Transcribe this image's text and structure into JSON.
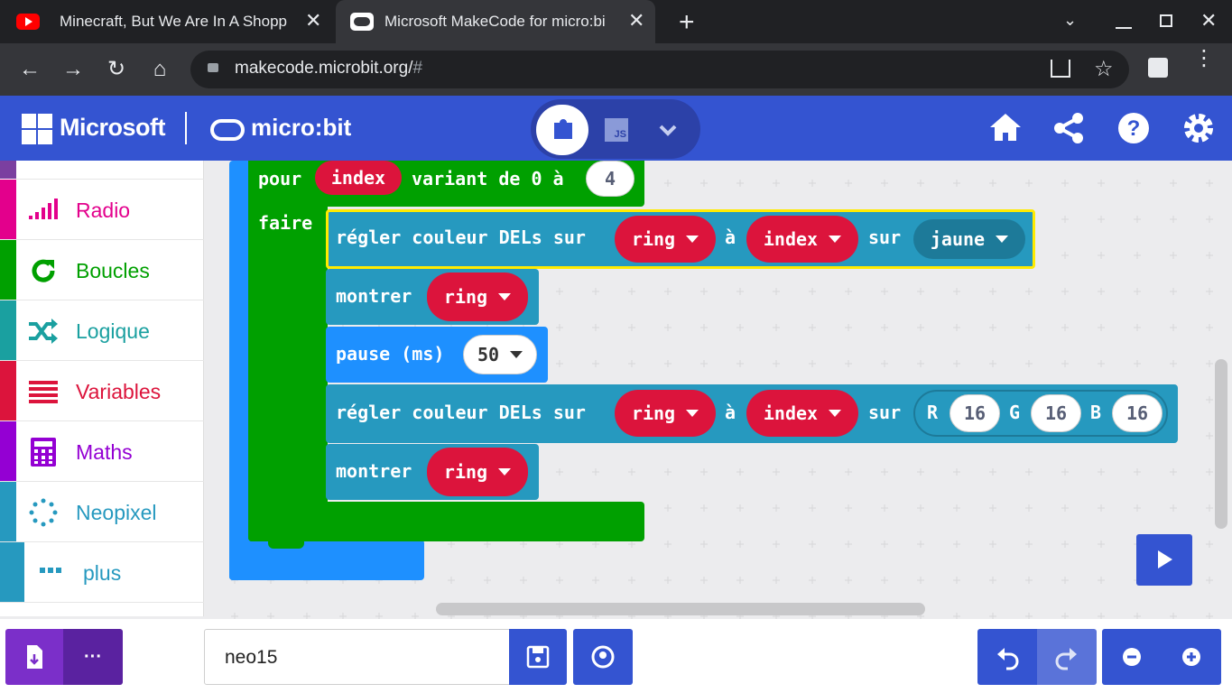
{
  "browser": {
    "tabs": [
      {
        "title": "Minecraft, But We Are In A Shopp",
        "icon": "youtube-icon"
      },
      {
        "title": "Microsoft MakeCode for micro:bi",
        "icon": "microbit-icon"
      }
    ],
    "url_main": "makecode.microbit.org/",
    "url_hash": "#"
  },
  "header": {
    "brand": "Microsoft",
    "product": "micro:bit",
    "js_label": "JS"
  },
  "toolbox": {
    "categories": [
      {
        "label": "Radio",
        "color": "#e3008c"
      },
      {
        "label": "Boucles",
        "color": "#00a000"
      },
      {
        "label": "Logique",
        "color": "#1aa0a0"
      },
      {
        "label": "Variables",
        "color": "#dc143c"
      },
      {
        "label": "Maths",
        "color": "#9400d3"
      },
      {
        "label": "Neopixel",
        "color": "#2699bf"
      },
      {
        "label": "plus",
        "color": "#2699bf"
      }
    ]
  },
  "blocks": {
    "loop": {
      "pour": "pour",
      "var": "index",
      "range": "variant de 0 à",
      "max": "4",
      "do": "faire"
    },
    "set1": {
      "text": "régler couleur DELs sur",
      "strip": "ring",
      "at": "à",
      "index": "index",
      "on": "sur",
      "color": "jaune"
    },
    "show1": {
      "text": "montrer",
      "strip": "ring"
    },
    "pause": {
      "text": "pause (ms)",
      "value": "50"
    },
    "set2": {
      "text": "régler couleur DELs sur",
      "strip": "ring",
      "at": "à",
      "index": "index",
      "on": "sur",
      "r_label": "R",
      "r": "16",
      "g_label": "G",
      "g": "16",
      "b_label": "B",
      "b": "16"
    },
    "show2": {
      "text": "montrer",
      "strip": "ring"
    }
  },
  "footer": {
    "project_name": "neo15",
    "more_label": "···"
  },
  "colors": {
    "header": "#3454d1",
    "loops": "#00a000",
    "neopixel": "#2699bf",
    "variables": "#dc143c",
    "basic": "#1e90ff"
  }
}
